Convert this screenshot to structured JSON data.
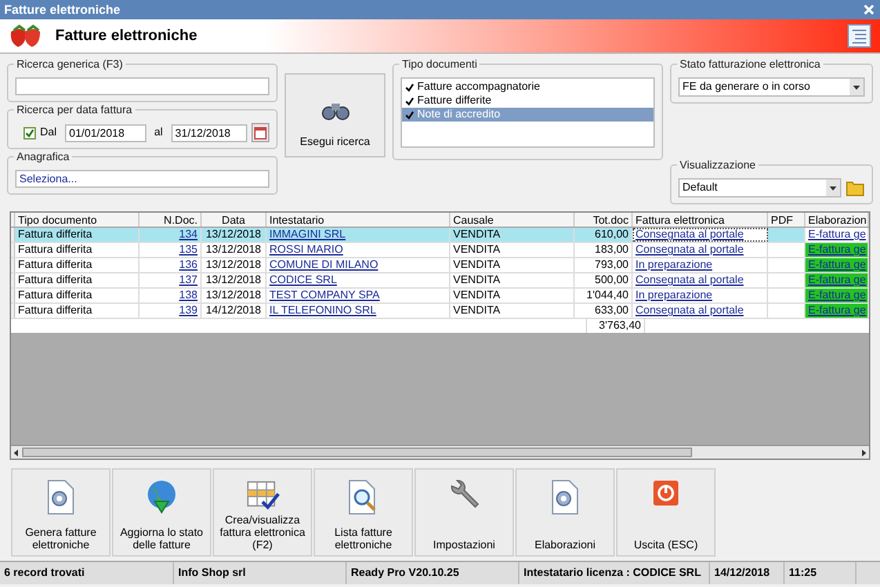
{
  "window": {
    "title": "Fatture elettroniche"
  },
  "header": {
    "title": "Fatture elettroniche"
  },
  "ricerca_generica": {
    "label": "Ricerca generica (F3)"
  },
  "ricerca_data": {
    "label": "Ricerca per data fattura",
    "dal": {
      "label": "Dal",
      "checked": true
    },
    "from": "01/01/2018",
    "to_label": "al",
    "to": "31/12/2018"
  },
  "anagrafica": {
    "label": "Anagrafica",
    "value": "Seleziona..."
  },
  "search_button": "Esegui ricerca",
  "tipo_documenti": {
    "label": "Tipo documenti",
    "items": [
      {
        "label": "Fatture accompagnatorie",
        "checked": true,
        "selected": false
      },
      {
        "label": "Fatture differite",
        "checked": true,
        "selected": false
      },
      {
        "label": "Note di accredito",
        "checked": true,
        "selected": true
      }
    ]
  },
  "stato": {
    "label": "Stato fatturazione elettronica",
    "value": "FE da generare o in corso"
  },
  "visualizzazione": {
    "label": "Visualizzazione",
    "value": "Default"
  },
  "table": {
    "columns": [
      "Tipo documento",
      "N.Doc.",
      "Data",
      "Intestatario",
      "Causale",
      "Tot.doc",
      "Fattura elettronica",
      "PDF",
      "Elaborazion"
    ],
    "rows": [
      {
        "selected": true,
        "tipo": "Fattura differita",
        "n_doc": "134",
        "data": "13/12/2018",
        "intestatario": "IMMAGINI SRL",
        "causale": "VENDITA",
        "tot_doc": "610,00",
        "fattura_elettronica": "Consegnata al portale",
        "elaborazione": "E-fattura ge"
      },
      {
        "selected": false,
        "tipo": "Fattura differita",
        "n_doc": "135",
        "data": "13/12/2018",
        "intestatario": "ROSSI MARIO",
        "causale": "VENDITA",
        "tot_doc": "183,00",
        "fattura_elettronica": "Consegnata al portale",
        "elaborazione": "E-fattura ge"
      },
      {
        "selected": false,
        "tipo": "Fattura differita",
        "n_doc": "136",
        "data": "13/12/2018",
        "intestatario": "COMUNE DI MILANO",
        "causale": "VENDITA",
        "tot_doc": "793,00",
        "fattura_elettronica": "In preparazione",
        "elaborazione": "E-fattura ge"
      },
      {
        "selected": false,
        "tipo": "Fattura differita",
        "n_doc": "137",
        "data": "13/12/2018",
        "intestatario": "CODICE SRL",
        "causale": "VENDITA",
        "tot_doc": "500,00",
        "fattura_elettronica": "Consegnata al portale",
        "elaborazione": "E-fattura ge"
      },
      {
        "selected": false,
        "tipo": "Fattura differita",
        "n_doc": "138",
        "data": "13/12/2018",
        "intestatario": "TEST COMPANY SPA",
        "causale": "VENDITA",
        "tot_doc": "1'044,40",
        "fattura_elettronica": "In preparazione",
        "elaborazione": "E-fattura ge"
      },
      {
        "selected": false,
        "tipo": "Fattura differita",
        "n_doc": "139",
        "data": "14/12/2018",
        "intestatario": "IL TELEFONINO SRL",
        "causale": "VENDITA",
        "tot_doc": "633,00",
        "fattura_elettronica": "Consegnata al portale",
        "elaborazione": "E-fattura ge"
      }
    ],
    "total": "3'763,40"
  },
  "toolbar": [
    {
      "kind": "gear-doc",
      "label": "Genera fatture elettroniche"
    },
    {
      "kind": "globe",
      "label": "Aggiorna lo stato delle fatture"
    },
    {
      "kind": "table",
      "label": "Crea/visualizza fattura elettronica (F2)"
    },
    {
      "kind": "magnifier",
      "label": "Lista fatture elettroniche"
    },
    {
      "kind": "wrench",
      "label": "Impostazioni"
    },
    {
      "kind": "gear-doc",
      "label": "Elaborazioni"
    },
    {
      "kind": "power",
      "label": "Uscita (ESC)"
    }
  ],
  "status_bar": [
    "6 record trovati",
    "Info Shop srl",
    "Ready Pro V20.10.25",
    "Intestatario licenza : CODICE SRL",
    "14/12/2018",
    "11:25"
  ]
}
